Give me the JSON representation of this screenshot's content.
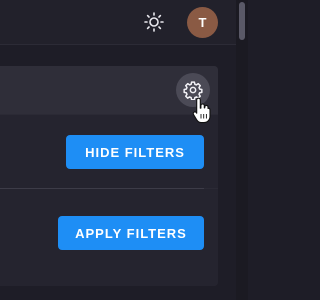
{
  "header": {
    "theme_toggle_icon": "sun-icon",
    "avatar_initial": "T",
    "avatar_color": "#8a5a44"
  },
  "filters": {
    "settings_icon": "gear-icon",
    "hide_filters_label": "HIDE FILTERS",
    "apply_filters_label": "APPLY FILTERS",
    "button_color": "#1e8ef5"
  }
}
